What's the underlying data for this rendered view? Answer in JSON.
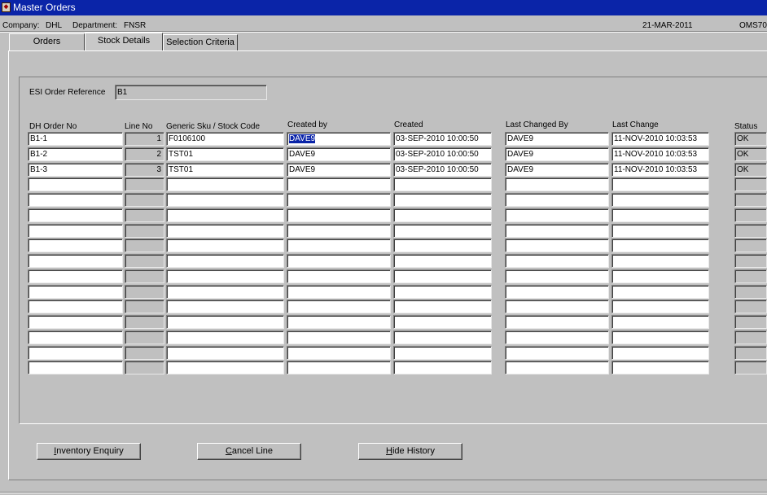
{
  "window": {
    "title": "Master Orders",
    "icon": "oracle-forms-icon"
  },
  "info": {
    "company_label": "Company:",
    "company_value": "DHL",
    "department_label": "Department:",
    "department_value": "FNSR",
    "date": "21-MAR-2011",
    "form_code": "OMS70"
  },
  "tabs": [
    {
      "label": "Orders",
      "active": false
    },
    {
      "label": "Stock Details",
      "active": true
    },
    {
      "label": "Selection Criteria",
      "active": false
    }
  ],
  "esi": {
    "label": "ESI Order Reference",
    "value": "B1"
  },
  "columns": {
    "dh_order_no": "DH Order No",
    "line_no": "Line No",
    "sku": "Generic Sku / Stock Code",
    "created_by": "Created by",
    "created": "Created",
    "last_changed_by": "Last Changed By",
    "last_change": "Last Change",
    "status": "Status"
  },
  "rows": [
    {
      "dh_order_no": "B1-1",
      "line_no": "1",
      "sku": "F0106100",
      "created_by": "DAVE9",
      "created": "03-SEP-2010 10:00:50",
      "last_changed_by": "DAVE9",
      "last_change": "11-NOV-2010 10:03:53",
      "status": "OK"
    },
    {
      "dh_order_no": "B1-2",
      "line_no": "2",
      "sku": "TST01",
      "created_by": "DAVE9",
      "created": "03-SEP-2010 10:00:50",
      "last_changed_by": "DAVE9",
      "last_change": "11-NOV-2010 10:03:53",
      "status": "OK"
    },
    {
      "dh_order_no": "B1-3",
      "line_no": "3",
      "sku": "TST01",
      "created_by": "DAVE9",
      "created": "03-SEP-2010 10:00:50",
      "last_changed_by": "DAVE9",
      "last_change": "11-NOV-2010 10:03:53",
      "status": "OK"
    },
    {
      "dh_order_no": "",
      "line_no": "",
      "sku": "",
      "created_by": "",
      "created": "",
      "last_changed_by": "",
      "last_change": "",
      "status": ""
    },
    {
      "dh_order_no": "",
      "line_no": "",
      "sku": "",
      "created_by": "",
      "created": "",
      "last_changed_by": "",
      "last_change": "",
      "status": ""
    },
    {
      "dh_order_no": "",
      "line_no": "",
      "sku": "",
      "created_by": "",
      "created": "",
      "last_changed_by": "",
      "last_change": "",
      "status": ""
    },
    {
      "dh_order_no": "",
      "line_no": "",
      "sku": "",
      "created_by": "",
      "created": "",
      "last_changed_by": "",
      "last_change": "",
      "status": ""
    },
    {
      "dh_order_no": "",
      "line_no": "",
      "sku": "",
      "created_by": "",
      "created": "",
      "last_changed_by": "",
      "last_change": "",
      "status": ""
    },
    {
      "dh_order_no": "",
      "line_no": "",
      "sku": "",
      "created_by": "",
      "created": "",
      "last_changed_by": "",
      "last_change": "",
      "status": ""
    },
    {
      "dh_order_no": "",
      "line_no": "",
      "sku": "",
      "created_by": "",
      "created": "",
      "last_changed_by": "",
      "last_change": "",
      "status": ""
    },
    {
      "dh_order_no": "",
      "line_no": "",
      "sku": "",
      "created_by": "",
      "created": "",
      "last_changed_by": "",
      "last_change": "",
      "status": ""
    },
    {
      "dh_order_no": "",
      "line_no": "",
      "sku": "",
      "created_by": "",
      "created": "",
      "last_changed_by": "",
      "last_change": "",
      "status": ""
    },
    {
      "dh_order_no": "",
      "line_no": "",
      "sku": "",
      "created_by": "",
      "created": "",
      "last_changed_by": "",
      "last_change": "",
      "status": ""
    },
    {
      "dh_order_no": "",
      "line_no": "",
      "sku": "",
      "created_by": "",
      "created": "",
      "last_changed_by": "",
      "last_change": "",
      "status": ""
    },
    {
      "dh_order_no": "",
      "line_no": "",
      "sku": "",
      "created_by": "",
      "created": "",
      "last_changed_by": "",
      "last_change": "",
      "status": ""
    },
    {
      "dh_order_no": "",
      "line_no": "",
      "sku": "",
      "created_by": "",
      "created": "",
      "last_changed_by": "",
      "last_change": "",
      "status": ""
    }
  ],
  "selected_cell": {
    "row": 0,
    "column": "created_by"
  },
  "buttons": {
    "inventory_enquiry": {
      "mnemonic": "I",
      "rest": "nventory Enquiry"
    },
    "cancel_line": {
      "mnemonic": "C",
      "rest": "ancel Line"
    },
    "hide_history": {
      "mnemonic": "H",
      "rest": "ide History"
    }
  },
  "colors": {
    "titlebar": "#0a24a8",
    "background": "#c0c0c0",
    "selection": "#0a24a8"
  }
}
